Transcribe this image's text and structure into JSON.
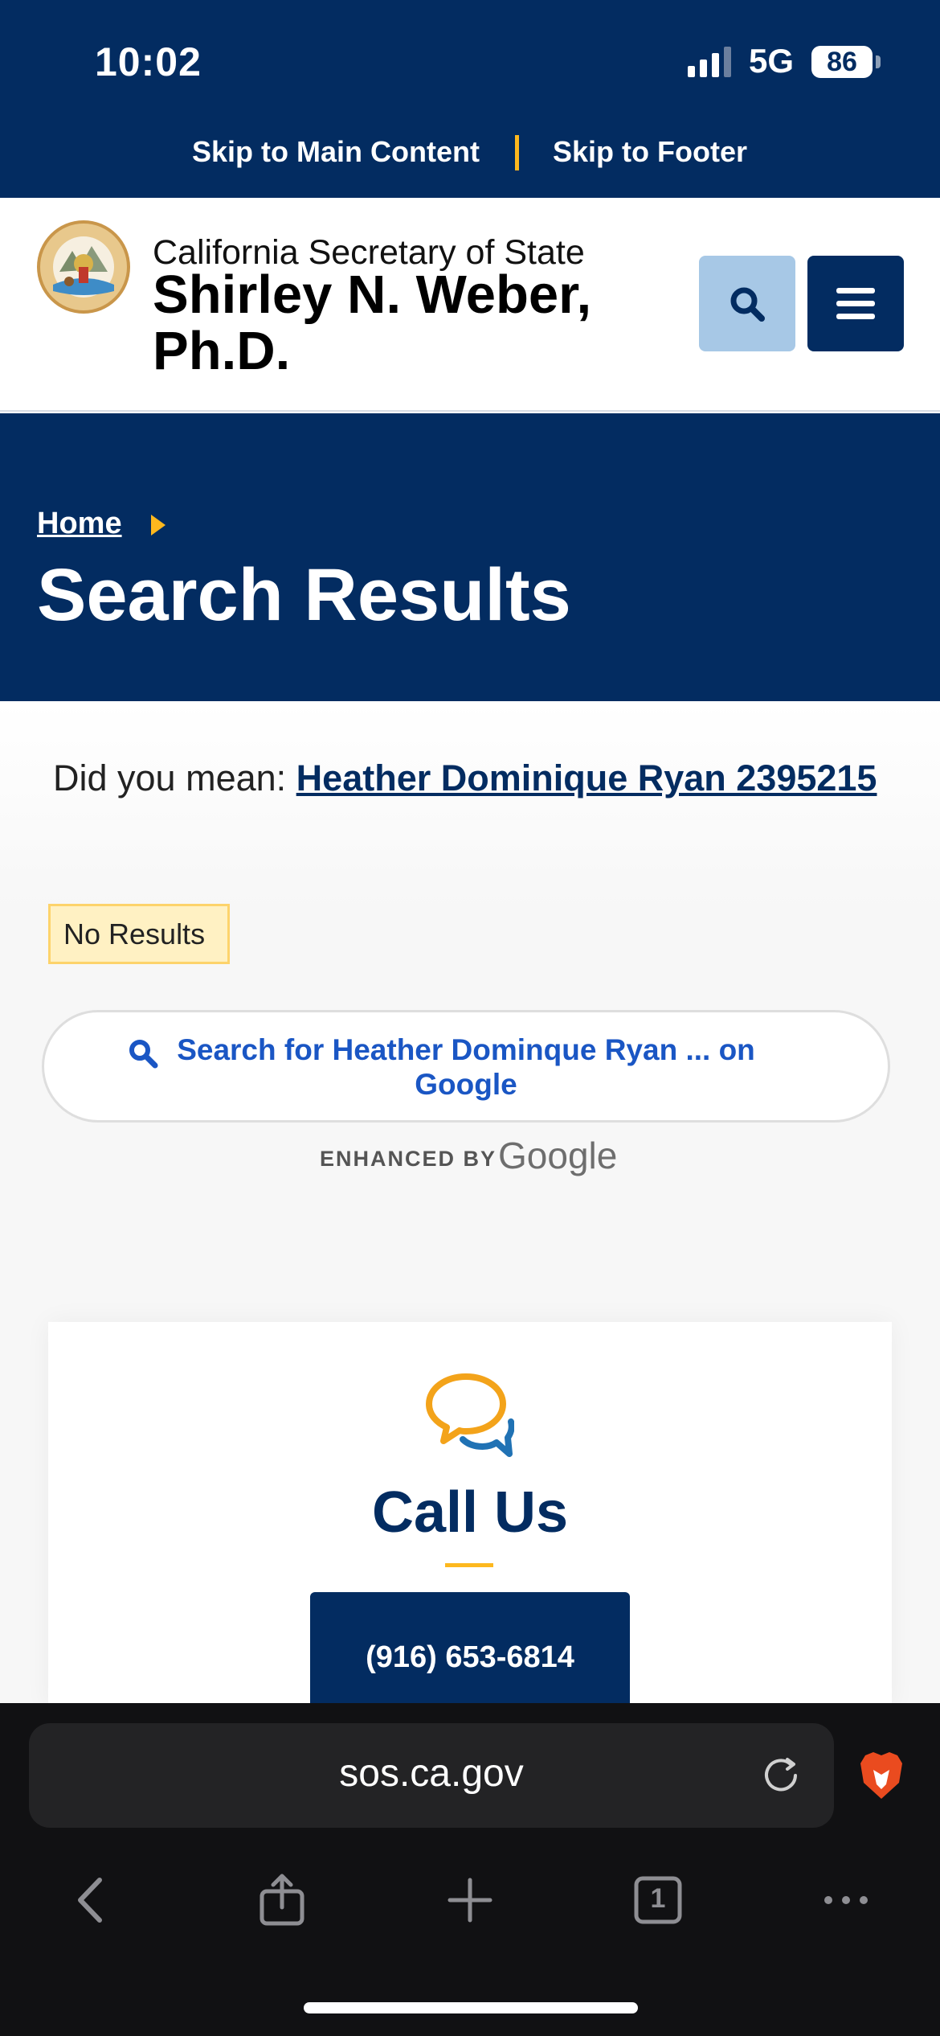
{
  "status_bar": {
    "time": "10:02",
    "network": "5G",
    "battery": "86"
  },
  "skip_links": {
    "main": "Skip to Main Content",
    "footer": "Skip to Footer"
  },
  "header": {
    "agency": "California Secretary of State",
    "official": "Shirley N. Weber, Ph.D.",
    "seal_text": "THE GREAT SEAL OF THE STATE OF CALIFORNIA",
    "seal_motto": "EUREKA"
  },
  "hero": {
    "breadcrumb_home": "Home",
    "title": "Search Results"
  },
  "results": {
    "did_you_mean_prefix": "Did you mean:",
    "did_you_mean_link": "Heather Dominique Ryan 2395215",
    "no_results": "No Results",
    "google_button": "Search for Heather Dominque Ryan ...  on Google",
    "enhanced_by": "ENHANCED BY",
    "google_word": "Google"
  },
  "call_us": {
    "title": "Call Us",
    "phone": "(916) 653-6814"
  },
  "browser": {
    "url": "sos.ca.gov"
  },
  "icons": {
    "search": "search-icon",
    "menu": "hamburger-menu-icon",
    "chat": "chat-bubbles-icon",
    "reload": "reload-icon",
    "brave": "brave-lion-icon",
    "back": "back-chevron-icon",
    "share": "share-icon",
    "new_tab": "plus-icon",
    "tabs": "tabs-count-icon",
    "more": "more-dots-icon"
  },
  "colors": {
    "navy": "#032c61",
    "gold": "#fdb81e",
    "link_blue": "#1a56c4",
    "search_btn": "#a7c8e6"
  },
  "tabs_count": "1"
}
